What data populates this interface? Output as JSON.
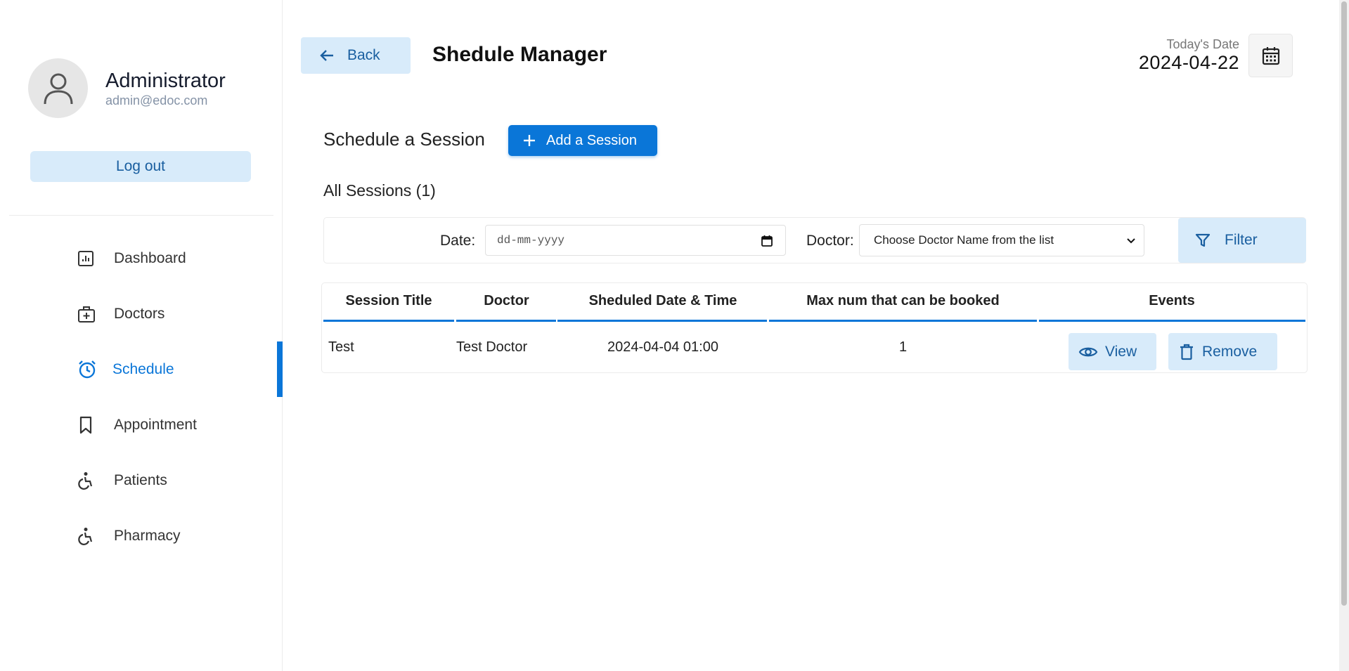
{
  "sidebar": {
    "profile": {
      "name": "Administrator",
      "email": "admin@edoc.com"
    },
    "logout_label": "Log out",
    "items": [
      {
        "label": "Dashboard",
        "icon": "dashboard-icon",
        "active": false
      },
      {
        "label": "Doctors",
        "icon": "medical-kit-icon",
        "active": false
      },
      {
        "label": "Schedule",
        "icon": "alarm-clock-icon",
        "active": true
      },
      {
        "label": "Appointment",
        "icon": "bookmark-icon",
        "active": false
      },
      {
        "label": "Patients",
        "icon": "wheelchair-icon",
        "active": false
      },
      {
        "label": "Pharmacy",
        "icon": "wheelchair-icon",
        "active": false
      }
    ]
  },
  "header": {
    "back_label": "Back",
    "title": "Shedule Manager",
    "date_label": "Today's Date",
    "date_value": "2024-04-22"
  },
  "main": {
    "section_title": "Schedule a Session",
    "add_label": "Add a Session",
    "all_sessions_label": "All Sessions (1)",
    "filter": {
      "date_label": "Date:",
      "date_placeholder": "dd-mm-yyyy",
      "doctor_label": "Doctor:",
      "doctor_selected": "Choose Doctor Name from the list",
      "filter_label": "Filter"
    },
    "table": {
      "columns": [
        "Session Title",
        "Doctor",
        "Sheduled Date & Time",
        "Max num that can be booked",
        "Events"
      ],
      "rows": [
        {
          "title": "Test",
          "doctor": "Test Doctor",
          "datetime": "2024-04-04 01:00",
          "max": "1",
          "view_label": "View",
          "remove_label": "Remove"
        }
      ]
    }
  },
  "colors": {
    "accent": "#0a76d8",
    "soft_accent": "#d8ebfa",
    "soft_text": "#1a5fa0"
  }
}
